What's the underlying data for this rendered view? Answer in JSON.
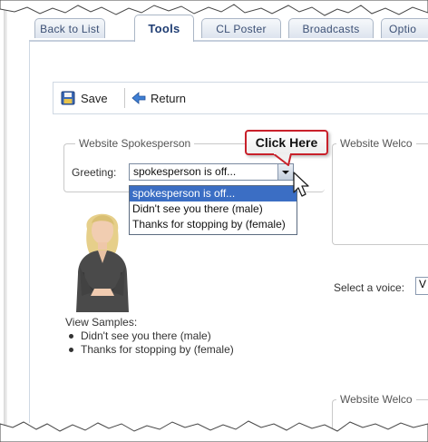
{
  "tabs": [
    {
      "label": "Back to List",
      "active": false
    },
    {
      "label": "Tools",
      "active": true
    },
    {
      "label": "CL Poster",
      "active": false
    },
    {
      "label": "Broadcasts",
      "active": false
    },
    {
      "label": "Optio",
      "active": false
    }
  ],
  "toolbar": {
    "save_label": "Save",
    "return_label": "Return"
  },
  "spokesperson": {
    "legend": "Website Spokesperson",
    "greeting_label": "Greeting:",
    "greeting_value": "spokesperson is off...",
    "options": [
      "spokesperson is off...",
      "Didn't see you there (male)",
      "Thanks for stopping by (female)"
    ],
    "selected_index": 0
  },
  "callout": {
    "text": "Click Here"
  },
  "welcome": {
    "legend": "Website Welco",
    "voice_label": "Select a voice:",
    "voice_value": "V",
    "bottom_legend": "Website Welco"
  },
  "samples": {
    "heading": "View Samples:",
    "items": [
      "Didn't see you there (male)",
      "Thanks for stopping by (female)"
    ]
  },
  "colors": {
    "callout_border": "#c8202a",
    "selection": "#3b6ec4",
    "tab_text": "#3c5075"
  }
}
